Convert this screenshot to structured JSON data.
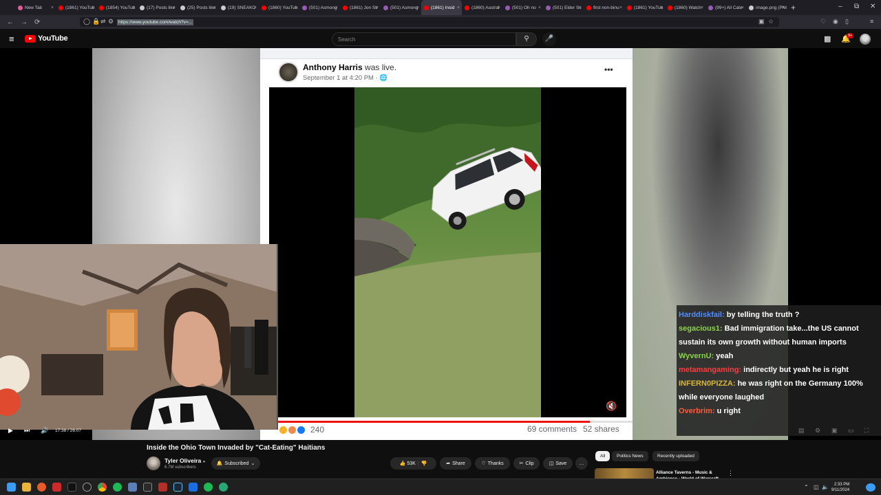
{
  "browser": {
    "tabs": [
      {
        "title": "New Tab",
        "color": "#e25c9a"
      },
      {
        "title": "(1861) YouTub",
        "color": "#ff0000"
      },
      {
        "title": "(1854) YouTub",
        "color": "#ff0000"
      },
      {
        "title": "(17) Posts like",
        "color": "#cccccc"
      },
      {
        "title": "(25) Posts like",
        "color": "#cccccc"
      },
      {
        "title": "(19) SNEAKO",
        "color": "#cccccc"
      },
      {
        "title": "(1860) YouTub",
        "color": "#ff0000"
      },
      {
        "title": "(501) Asmong",
        "color": "#9b59b6"
      },
      {
        "title": "(1861) Jon Str",
        "color": "#ff0000"
      },
      {
        "title": "(501) Asmong",
        "color": "#9b59b6"
      },
      {
        "title": "(1861) Insid",
        "color": "#ff0000",
        "active": true
      },
      {
        "title": "(1860) Austral",
        "color": "#ff0000"
      },
      {
        "title": "(501) Oh no",
        "color": "#9b59b6"
      },
      {
        "title": "(501) Elder Sc",
        "color": "#9b59b6"
      },
      {
        "title": "first non-binu",
        "color": "#ff0000"
      },
      {
        "title": "(1861) YouTub",
        "color": "#ff0000"
      },
      {
        "title": "(1860) Watch",
        "color": "#ff0000"
      },
      {
        "title": "(99+) All Cate",
        "color": "#9b59b6"
      },
      {
        "title": "image.png (PNG I",
        "color": "#cccccc"
      }
    ],
    "new_tab_label": "+",
    "url": "https://www.youtube.com/watch?v=...",
    "window_controls": {
      "minimize": "–",
      "restore": "⧉",
      "close": "✕"
    }
  },
  "youtube": {
    "logo_text": "YouTube",
    "search_placeholder": "Search",
    "notifications_badge": "9+"
  },
  "video": {
    "fb_post": {
      "author": "Anthony Harris",
      "action": "was live.",
      "date": "September 1 at 4:20 PM ·",
      "reaction_count": "240",
      "comments": "69 comments",
      "shares": "52 shares",
      "progress": 0.88
    },
    "chat": [
      {
        "user": "Harddiskfail:",
        "color": "#4f8cff",
        "text": "by telling the truth ?"
      },
      {
        "user": "segacious1:",
        "color": "#8bd34a",
        "text": "Bad immigration take...the US cannot sustain its own growth without human imports"
      },
      {
        "user": "WyvernU:",
        "color": "#8bd34a",
        "text": "yeah"
      },
      {
        "user": "metamangaming:",
        "color": "#ff3b3b",
        "text": "indirectly but yeah he is right"
      },
      {
        "user": "INFERN0PIZZA:",
        "color": "#d9b73a",
        "text": "he was right on the Germany 100% while everyone laughed"
      },
      {
        "user": "Overbrim:",
        "color": "#ff5a3a",
        "text": "u right"
      }
    ],
    "time_current": "17:38",
    "time_total": "26:07",
    "time_separator": " / ",
    "progress": 0.675
  },
  "info": {
    "title": "Inside the Ohio Town Invaded by \"Cat-Eating\" Haitians",
    "channel": "Tyler Oliveira",
    "verified": "●",
    "subscribers": "6.7M subscribers",
    "subscribe_label": "Subscribed",
    "likes": "53K",
    "share": "Share",
    "thanks": "Thanks",
    "clip": "Clip",
    "save": "Save",
    "more": "…"
  },
  "sidebar": {
    "chips": [
      "All",
      "Politics News",
      "Recently uploaded"
    ],
    "rec_title_line1": "Alliance Taverns - Music &",
    "rec_title_line2": "Ambience - World of Warcraft"
  },
  "taskbar": {
    "time": "2:33 PM",
    "date": "9/11/2024"
  }
}
